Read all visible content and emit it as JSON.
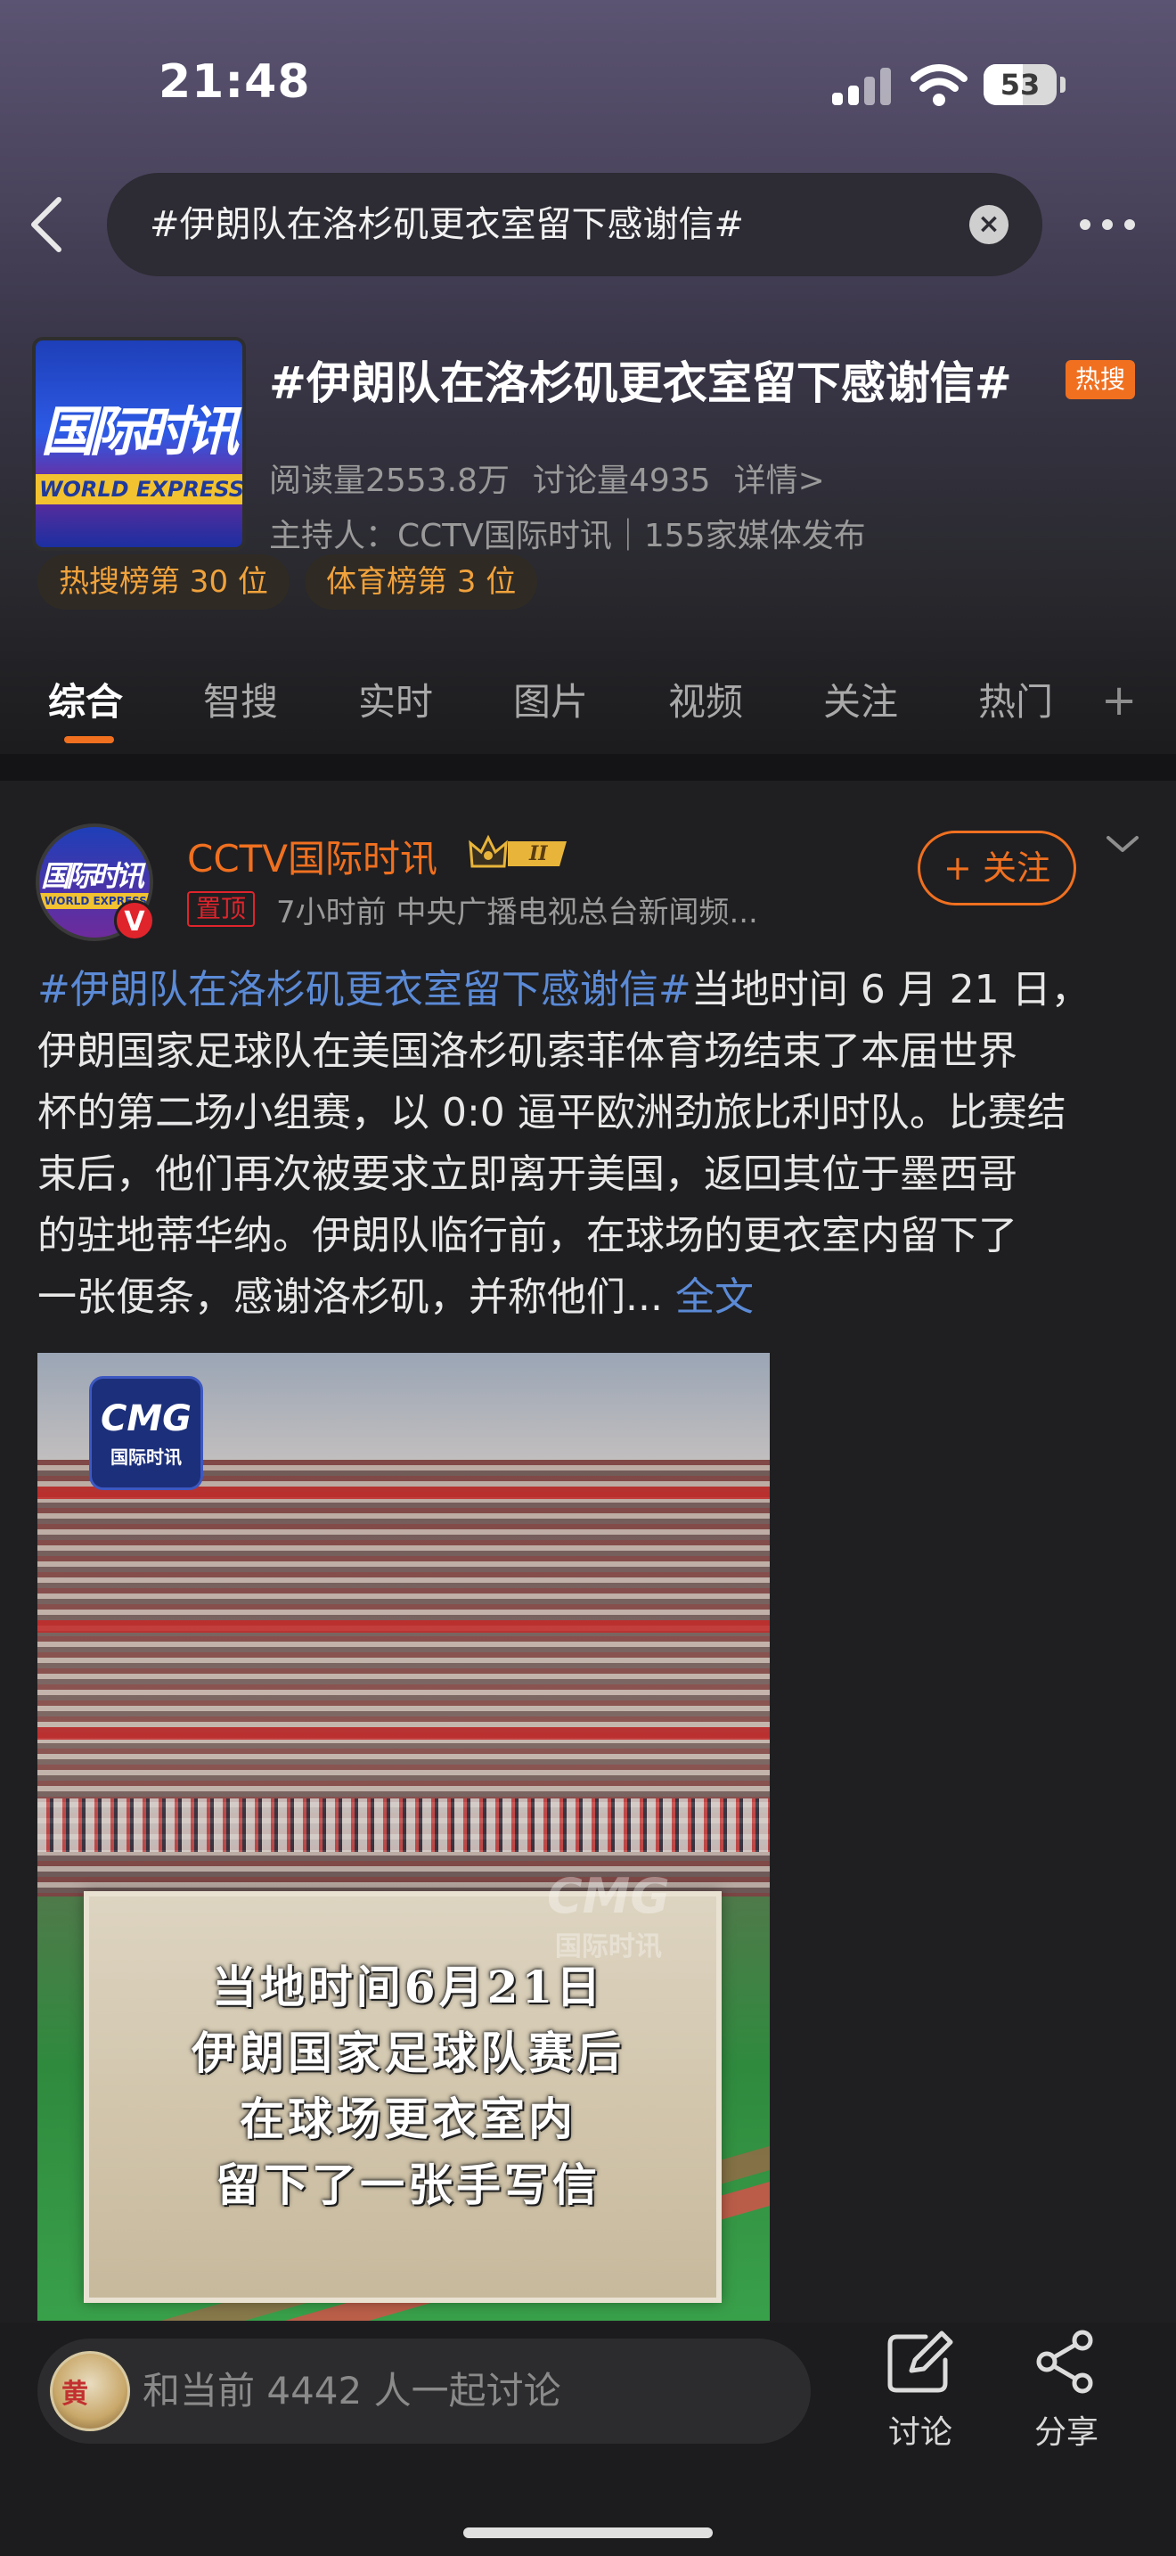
{
  "status_bar": {
    "time": "21:48",
    "battery": "53",
    "battery_level_percent": 53
  },
  "header": {
    "search_query": "#伊朗队在洛杉矶更衣室留下感谢信#"
  },
  "topic": {
    "logo_text_cn": "国际时讯",
    "logo_text_en": "WORLD EXPRESS",
    "title": "#伊朗队在洛杉矶更衣室留下感谢信#",
    "hot_badge": "热搜",
    "reads": "阅读量2553.8万",
    "discussions": "讨论量4935",
    "details_link": "详情>",
    "host_line": "主持人：CCTV国际时讯｜155家媒体发布",
    "ranks": [
      "热搜榜第 30 位",
      "体育榜第 3 位"
    ]
  },
  "tabs": [
    {
      "label": "综合",
      "active": true
    },
    {
      "label": "智搜",
      "active": false
    },
    {
      "label": "实时",
      "active": false
    },
    {
      "label": "图片",
      "active": false
    },
    {
      "label": "视频",
      "active": false
    },
    {
      "label": "关注",
      "active": false
    },
    {
      "label": "热门",
      "active": false
    }
  ],
  "post": {
    "author_avatar_text": "国际时讯",
    "author_avatar_en": "WORLD EXPRESS",
    "verified_mark": "V",
    "author_name": "CCTV国际时讯",
    "level_badge": "II",
    "pinned_label": "置顶",
    "meta": "7小时前  中央广播电视总台新闻频...",
    "follow_label": "+ 关注",
    "hashtag": "#伊朗队在洛杉矶更衣室留下感谢信#",
    "body_line_1": "当地时间 6 月 21 日，",
    "body_line_2": "伊朗国家足球队在美国洛杉矶索菲体育场结束了本届世界",
    "body_line_3": "杯的第二场小组赛，以 0:0 逼平欧洲劲旅比利时队。比赛结",
    "body_line_4": "束后，他们再次被要求立即离开美国，返回其位于墨西哥",
    "body_line_5": "的驻地蒂华纳。伊朗队临行前，在球场的更衣室内留下了",
    "body_line_6": "一张便条，感谢洛杉矶，并称他们...",
    "more_link": "全文",
    "video": {
      "logo_main": "CMG",
      "logo_sub": "国际时讯",
      "watermark_main": "CMG",
      "watermark_sub": "国际时讯",
      "caption_lines": [
        "当地时间6月21日",
        "伊朗国家足球队赛后",
        "在球场更衣室内",
        "留下了一张手写信"
      ]
    }
  },
  "bottom": {
    "avatar_text": "黄",
    "comment_placeholder": "和当前 4442 人一起讨论",
    "discuss_label": "讨论",
    "share_label": "分享"
  },
  "colors": {
    "accent": "#f07020",
    "link": "#5b8ad6",
    "verified": "#e0242c",
    "background": "#1c1c1e"
  }
}
